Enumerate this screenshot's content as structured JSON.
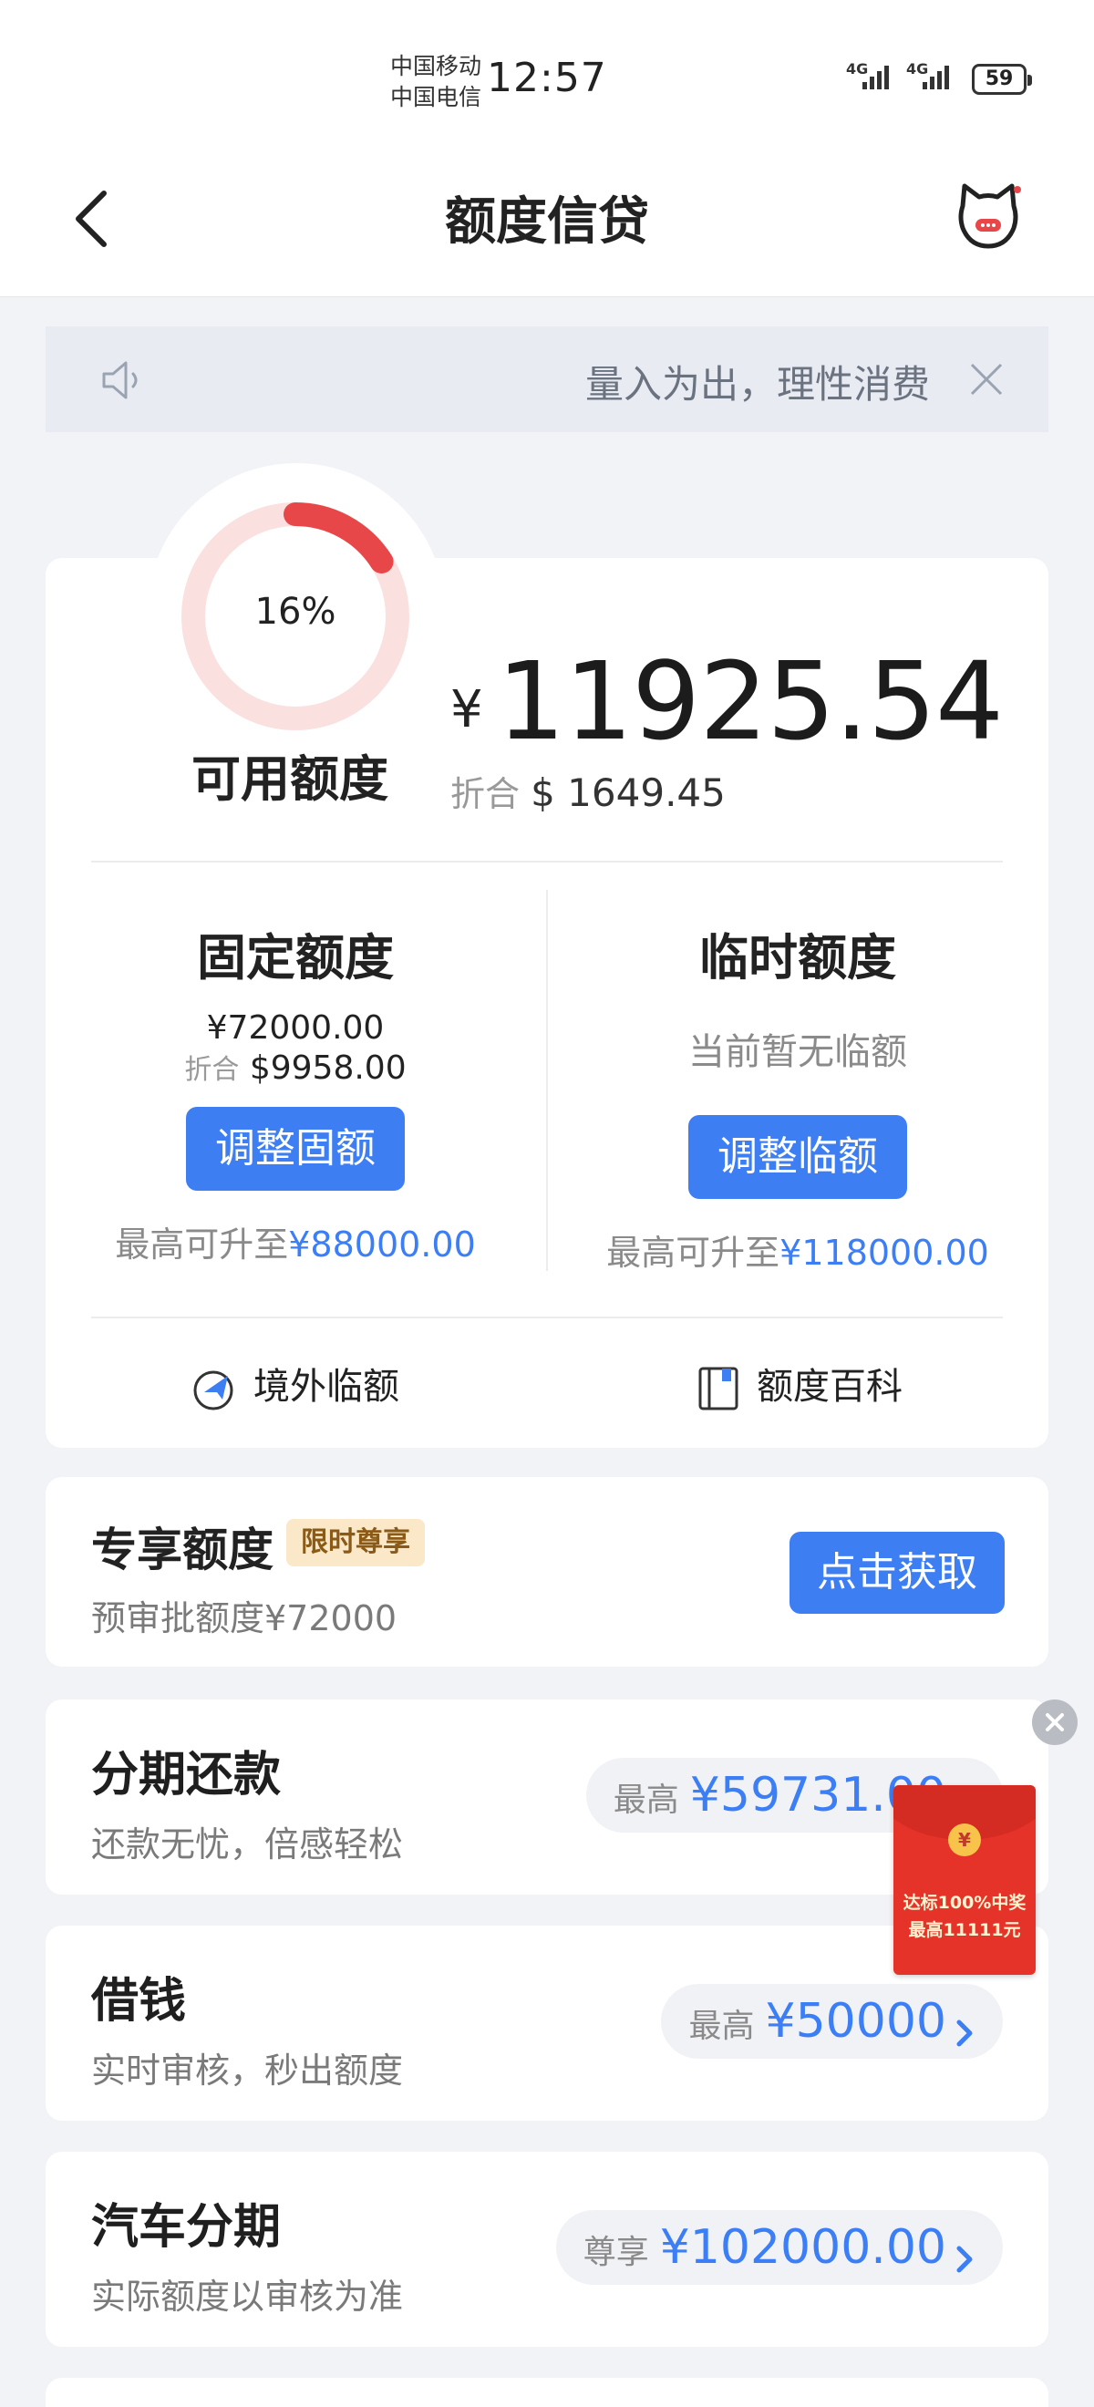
{
  "status_bar": {
    "carrier_1": "中国移动",
    "carrier_2": "中国电信",
    "time": "12:57",
    "network_1": "4G",
    "network_2": "4G",
    "battery": "59"
  },
  "header": {
    "title": "额度信贷",
    "back_icon": "chevron-left-icon",
    "assistant_icon": "cat-mascot-icon"
  },
  "notice": {
    "text": "量入为出，理性消费",
    "speaker_icon": "speaker-icon",
    "close_icon": "close-icon"
  },
  "credit": {
    "usage_percent": 16,
    "usage_label": "16%",
    "available_label": "可用额度",
    "currency_symbol": "¥",
    "available_amount": "11925.54",
    "converted_label": "折合",
    "converted_amount": "$ 1649.45",
    "fixed": {
      "title": "固定额度",
      "amount": "¥72000.00",
      "converted_label": "折合",
      "converted_amount": "$9958.00",
      "button": "调整固额",
      "max_prefix": "最高可升至",
      "max_value": "¥88000.00"
    },
    "temporary": {
      "title": "临时额度",
      "status": "当前暂无临额",
      "button": "调整临额",
      "max_prefix": "最高可升至",
      "max_value": "¥118000.00"
    },
    "links": {
      "overseas": "境外临额",
      "encyclopedia": "额度百科"
    }
  },
  "exclusive": {
    "title": "专享额度",
    "tag": "限时尊享",
    "subtitle": "预审批额度¥72000",
    "button": "点击获取"
  },
  "products": [
    {
      "title": "分期还款",
      "subtitle": "还款无忧，倍感轻松",
      "pill_label": "最高",
      "pill_value": "¥59731.00"
    },
    {
      "title": "借钱",
      "subtitle": "实时审核，秒出额度",
      "pill_label": "最高",
      "pill_value": "¥50000"
    },
    {
      "title": "汽车分期",
      "subtitle": "实际额度以审核为准",
      "pill_label": "尊享",
      "pill_value": "¥102000.00"
    }
  ],
  "red_packet": {
    "coin": "¥",
    "line1": "达标100%中奖",
    "line2": "最高11111元"
  },
  "colors": {
    "accent_blue": "#3d7ef2",
    "ring_red": "#e8474a",
    "tag_gold_bg": "#fbe8c9"
  }
}
